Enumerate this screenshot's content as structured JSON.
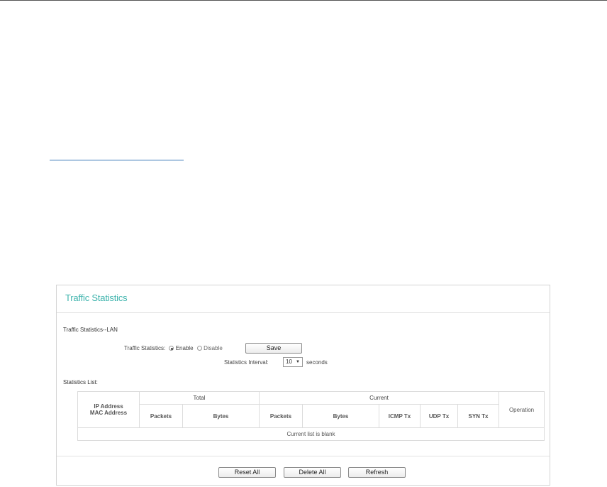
{
  "panel": {
    "title": "Traffic Statistics"
  },
  "lan_section": {
    "heading": "Traffic Statistics--LAN",
    "traffic_statistics_label": "Traffic Statistics:",
    "enable_label": "Enable",
    "disable_label": "Disable",
    "selected": "Enable",
    "save_label": "Save",
    "interval_label": "Statistics Interval:",
    "interval_value": "10",
    "interval_unit": "seconds"
  },
  "statistics_list": {
    "heading": "Statistics List:",
    "group_headers": {
      "total": "Total",
      "current": "Current"
    },
    "columns": {
      "ip_address": "IP Address",
      "mac_address": "MAC Address",
      "total_packets": "Packets",
      "total_bytes": "Bytes",
      "current_packets": "Packets",
      "current_bytes": "Bytes",
      "icmp_tx": "ICMP Tx",
      "udp_tx": "UDP Tx",
      "syn_tx": "SYN Tx",
      "operation": "Operation"
    },
    "empty_message": "Current list is blank"
  },
  "footer": {
    "reset_all_label": "Reset All",
    "delete_all_label": "Delete All",
    "refresh_label": "Refresh"
  },
  "colors": {
    "title_accent": "#3fb4ad",
    "link_underline": "#3a79b8"
  }
}
